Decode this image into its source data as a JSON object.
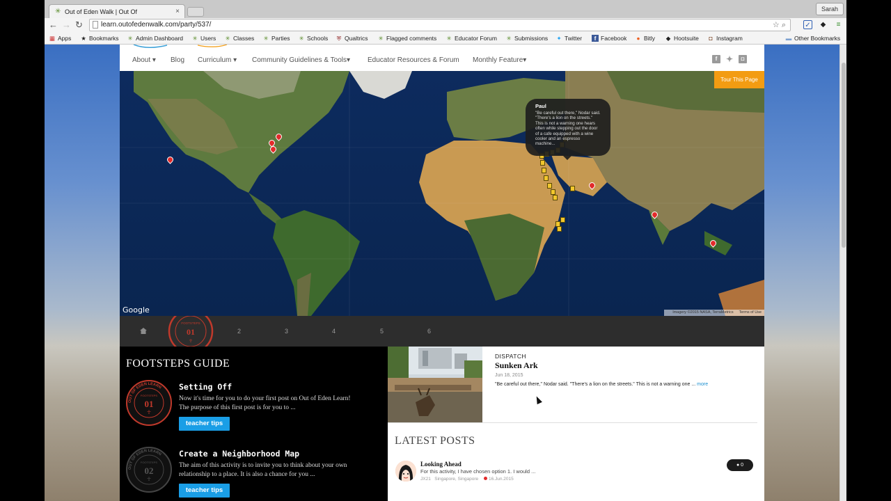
{
  "browser": {
    "tab_title": "Out of Eden Walk | Out Of",
    "profile_name": "Sarah",
    "url": "learn.outofedenwalk.com/party/537/",
    "bookmarks": [
      "Apps",
      "Bookmarks",
      "Admin Dashboard",
      "Users",
      "Classes",
      "Parties",
      "Schools",
      "Qualtrics",
      "Flagged comments",
      "Educator Forum",
      "Submissions",
      "Twitter",
      "Facebook",
      "Bitly",
      "Hootsuite",
      "Instagram"
    ],
    "other_bookmarks": "Other Bookmarks"
  },
  "nav": {
    "items": [
      "About",
      "Blog",
      "Curriculum",
      "Community Guidelines & Tools",
      "Educator Resources & Forum",
      "Monthly Feature"
    ],
    "tour_button": "Tour This Page"
  },
  "map": {
    "google_label": "Google",
    "attribution": "Imagery ©2015 NASA, TerraMetrics",
    "terms": "Terms of Use",
    "popup": {
      "name": "Paul",
      "text": "\"Be careful out there,\" Nodar said. \"There's a lion on the streets.\" This is not a warning one hears often while stepping out the door of a cafe equipped with a wine cooler and an espresso machine..."
    }
  },
  "chapters": {
    "active_number": "01",
    "active_label": "FOOTSTEPS",
    "items": [
      "2",
      "3",
      "4",
      "5",
      "6"
    ]
  },
  "guide": {
    "heading": "FOOTSTEPS GUIDE",
    "steps": [
      {
        "number": "01",
        "title": "Setting Off",
        "body": "Now it's time for you to do your first post on Out of Eden Learn! The purpose of this first post is for you to ...",
        "button": "teacher tips"
      },
      {
        "number": "02",
        "title": "Create a Neighborhood Map",
        "body": "The aim of this activity is to invite you to think about your own relationship to a place. It is also a chance for you ...",
        "button": "teacher tips"
      }
    ],
    "stamp_ring": "OUT OF EDEN LEARN",
    "stamp_label": "FOOTSTEPS"
  },
  "dispatch": {
    "label": "DISPATCH",
    "title": "Sunken Ark",
    "date": "Jun 18, 2015",
    "excerpt": "\"Be careful out there,\" Nodar said. \"There's a lion on the streets.\" This is not a warning one ...",
    "more": "more"
  },
  "latest": {
    "heading": "LATEST POSTS",
    "post": {
      "title": "Looking Ahead",
      "body": "For this activity, I have chosen option 1. I would ...",
      "user": "JX21",
      "location": "Singapore, Singapore",
      "date": "16.Jun.2015",
      "comments": "0"
    }
  }
}
